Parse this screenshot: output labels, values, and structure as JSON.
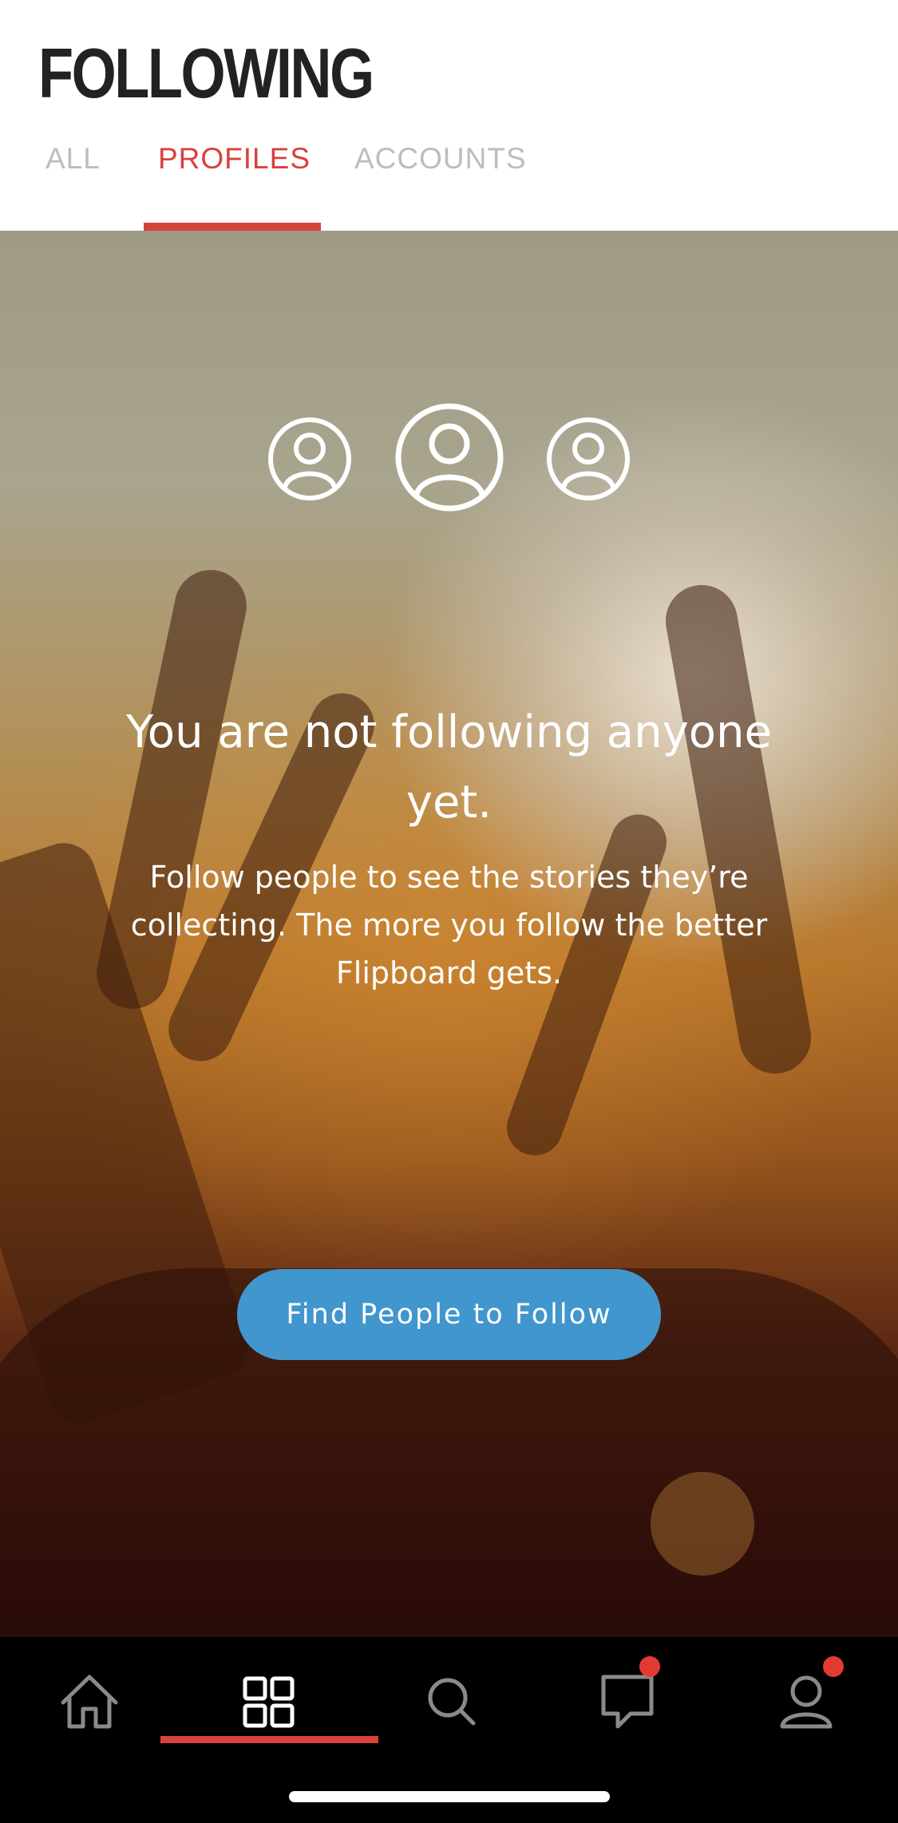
{
  "header": {
    "title": "FOLLOWING",
    "tabs": [
      {
        "label": "ALL",
        "active": false
      },
      {
        "label": "PROFILES",
        "active": true
      },
      {
        "label": "ACCOUNTS",
        "active": false
      }
    ]
  },
  "empty_state": {
    "title": "You are not following anyone yet.",
    "description": "Follow people to see the stories they’re collecting. The more you follow the better Flipboard gets.",
    "button_label": "Find People to Follow",
    "icons": [
      "user-circle-icon",
      "user-circle-icon",
      "user-circle-icon"
    ]
  },
  "bottom_nav": {
    "items": [
      {
        "icon": "home-icon",
        "active": false,
        "badge": false
      },
      {
        "icon": "grid-icon",
        "active": true,
        "badge": false
      },
      {
        "icon": "search-icon",
        "active": false,
        "badge": false
      },
      {
        "icon": "chat-bubble-icon",
        "active": false,
        "badge": true
      },
      {
        "icon": "profile-icon",
        "active": false,
        "badge": true
      }
    ]
  },
  "colors": {
    "accent_red": "#d8413b",
    "button_blue": "#4196cd",
    "badge_red": "#e23b33",
    "inactive_tab": "#bdbdbd",
    "title_dark": "#222222"
  }
}
